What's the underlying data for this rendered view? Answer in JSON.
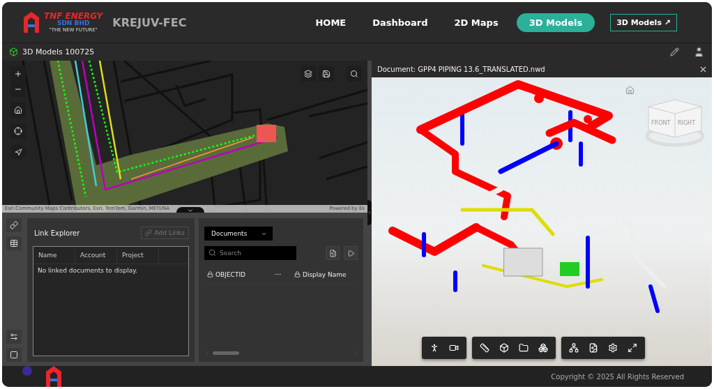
{
  "header": {
    "logo": {
      "name": "TNF ENERGY",
      "sub": "SDN BHD",
      "tagline": "\"THE NEW FUTURE\""
    },
    "app_title": "KREJUV-FEC",
    "nav": [
      {
        "label": "HOME",
        "selected": false
      },
      {
        "label": "Dashboard",
        "selected": false
      },
      {
        "label": "2D Maps",
        "selected": false
      },
      {
        "label": "3D Models",
        "selected": true
      }
    ],
    "external_link": "3D Models ↗"
  },
  "subheader": {
    "title": "3D Models 100725"
  },
  "map": {
    "attribution": "Esri Community Maps Contributors, Esri, TomTom, Garmin, METI/NA",
    "powered_by": "Powered by Es"
  },
  "link_explorer": {
    "title": "Link Explorer",
    "add_button": {
      "label": "Add Links",
      "disabled": true
    },
    "columns": [
      "Name",
      "Account",
      "Project"
    ],
    "empty_message": "No linked documents to display."
  },
  "documents": {
    "dropdown": "Documents",
    "search_placeholder": "Search",
    "columns": [
      "OBJECTID",
      "Display Name"
    ]
  },
  "viewer": {
    "title": "Document: GPP4 PIPING 13.6_TRANSLATED.nwd",
    "view_cube": [
      "FRONT",
      "RIGHT"
    ]
  },
  "footer": {
    "copyright": "Copyright © 2025 All Rights Reserved"
  }
}
